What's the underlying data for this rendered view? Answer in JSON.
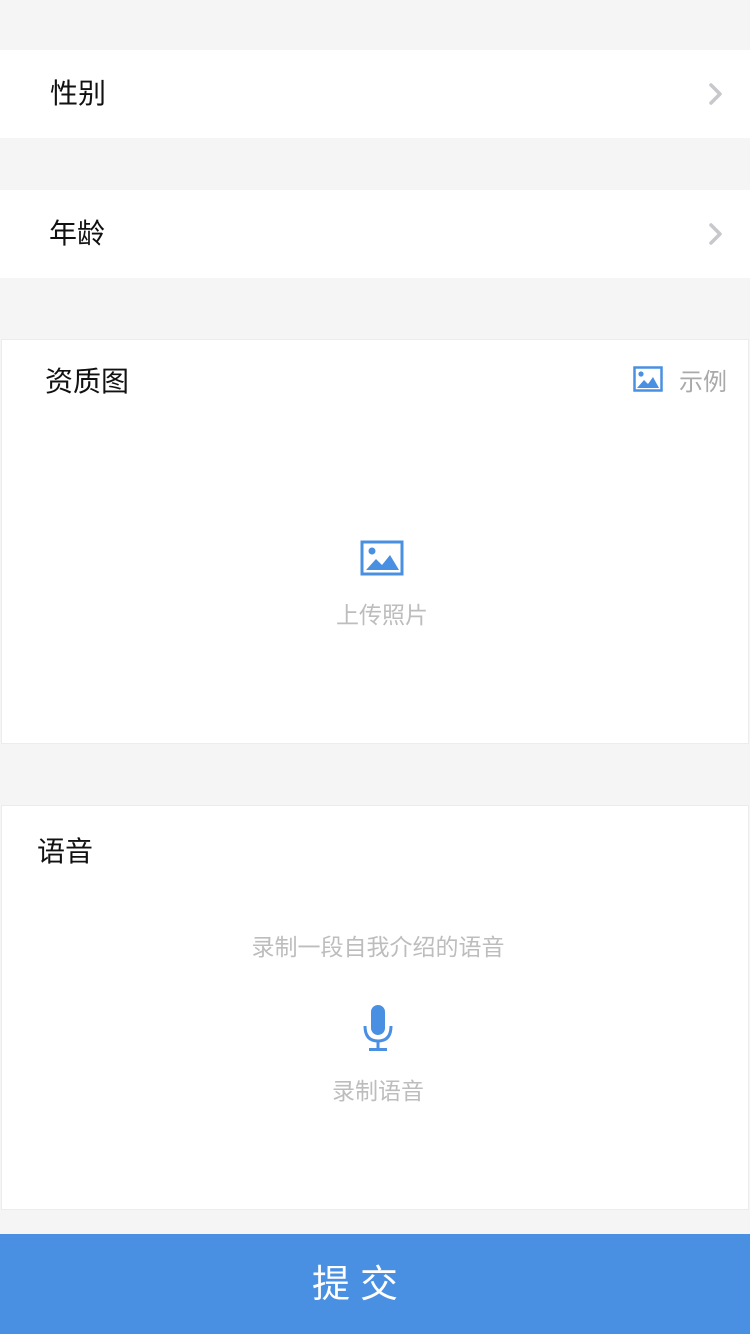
{
  "form": {
    "gender_label": "性别",
    "age_label": "年龄"
  },
  "photo": {
    "title": "资质图",
    "example_label": "示例",
    "upload_label": "上传照片"
  },
  "voice": {
    "title": "语音",
    "hint": "录制一段自我介绍的语音",
    "record_label": "录制语音"
  },
  "submit_label": "提交",
  "colors": {
    "accent": "#4a90e2",
    "page_background": "#f5f5f5",
    "hint_text": "#bdbdbd",
    "chevron": "#c7c7cc"
  },
  "icons": {
    "row_arrow": "chevron-right-icon",
    "example": "image-icon",
    "upload": "image-icon",
    "record": "microphone-icon"
  }
}
